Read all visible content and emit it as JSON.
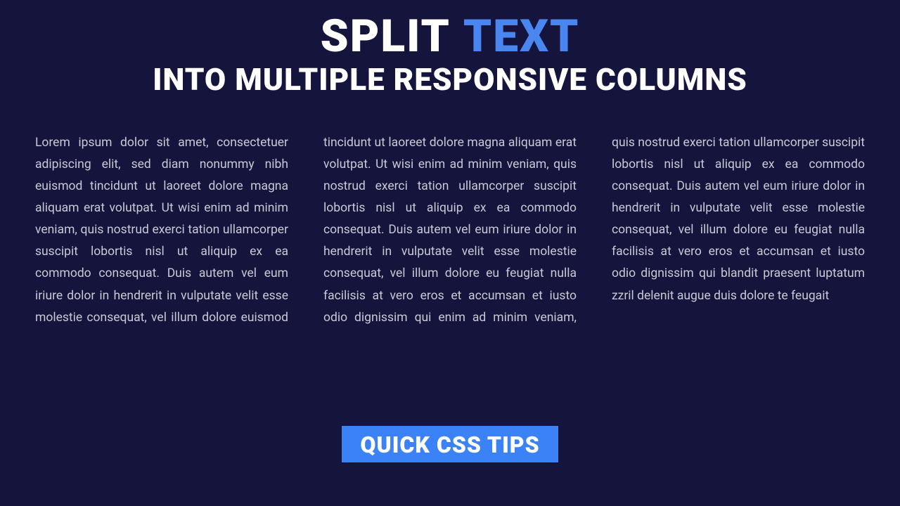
{
  "title": {
    "word1": "SPLIT",
    "word2": "TEXT"
  },
  "subtitle": "INTO MULTIPLE RESPONSIVE COLUMNS",
  "body_text": "Lorem ipsum dolor sit amet, consectetuer adipiscing elit, sed diam nonummy nibh euismod tincidunt ut laoreet dolore magna aliquam erat volutpat. Ut wisi enim ad minim veniam, quis nostrud exerci tation ullamcorper suscipit lobortis nisl ut aliquip ex ea commodo consequat. Duis autem vel eum iriure dolor in hendrerit in vulputate velit esse molestie consequat, vel illum dolore euismod tincidunt ut laoreet dolore magna aliquam erat volutpat. Ut wisi enim ad minim veniam, quis nostrud exerci tation ullamcorper suscipit lobortis nisl ut aliquip ex ea commodo consequat. Duis autem vel eum iriure dolor in hendrerit in vulputate velit esse molestie consequat, vel illum dolore eu feugiat nulla facilisis at vero eros et accumsan et iusto odio dignissim qui enim ad minim veniam, quis nostrud exerci tation ullamcorper suscipit lobortis nisl ut aliquip ex ea commodo consequat. Duis autem vel eum iriure dolor in hendrerit in vulputate velit esse molestie consequat, vel illum dolore eu feugiat nulla facilisis at vero eros et accumsan et iusto odio dignissim qui blandit praesent luptatum zzril delenit augue duis dolore te feugait",
  "badge": "QUICK CSS TIPS",
  "colors": {
    "background": "#14143c",
    "accent": "#3b82f6",
    "accent_light": "#4a86f0",
    "text_body": "#c9c9d6",
    "text_heading": "#ffffff"
  }
}
